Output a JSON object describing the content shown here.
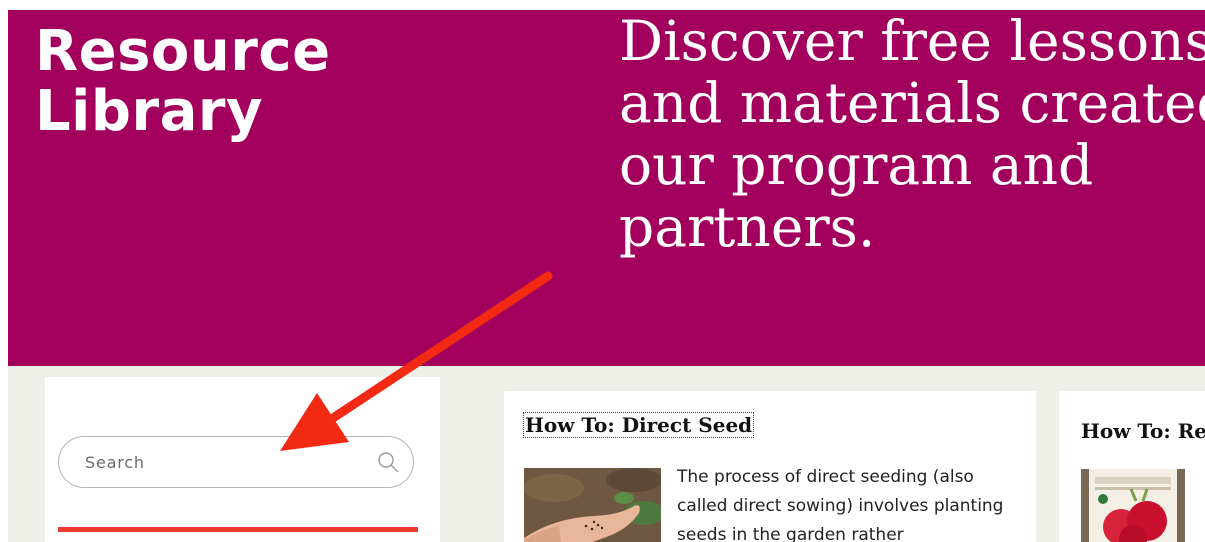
{
  "hero": {
    "title_lines": [
      "Resource",
      "Library"
    ],
    "tagline_lines": [
      "Discover free lessons",
      "and materials created",
      "our program and",
      "partners."
    ]
  },
  "sidebar": {
    "search": {
      "placeholder": "Search",
      "value": "",
      "icon": "search-icon"
    }
  },
  "cards": [
    {
      "title": "How To: Direct Seed",
      "text": "The process of direct seeding (also called direct sowing) involves planting seeds in the garden rather",
      "image": "hand-holding-seeds"
    },
    {
      "title": "How To: Re",
      "image": "beet-seed-packet"
    }
  ],
  "annotation": {
    "icon": "red-arrow-icon",
    "color": "#f22a13"
  },
  "colors": {
    "hero": "#a3005e",
    "accent": "#ee3a2f",
    "background": "#efefea"
  }
}
